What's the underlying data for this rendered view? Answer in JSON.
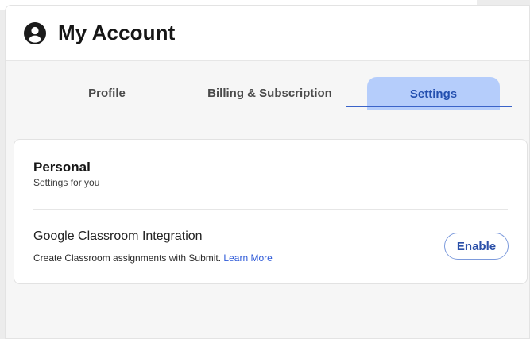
{
  "header": {
    "title": "My Account",
    "icon": "account-circle-icon"
  },
  "tabs": [
    {
      "label": "Profile",
      "active": false
    },
    {
      "label": "Billing & Subscription",
      "active": false
    },
    {
      "label": "Settings",
      "active": true
    }
  ],
  "personal": {
    "title": "Personal",
    "subtitle": "Settings for you",
    "integration": {
      "title": "Google Classroom Integration",
      "description": "Create Classroom assignments with Submit. ",
      "link_label": "Learn More",
      "button_label": "Enable"
    }
  },
  "colors": {
    "active_tab_bg": "#b5cdfb",
    "active_tab_text": "#2450b0",
    "accent": "#3a63c9",
    "link": "#2f5bd8"
  }
}
